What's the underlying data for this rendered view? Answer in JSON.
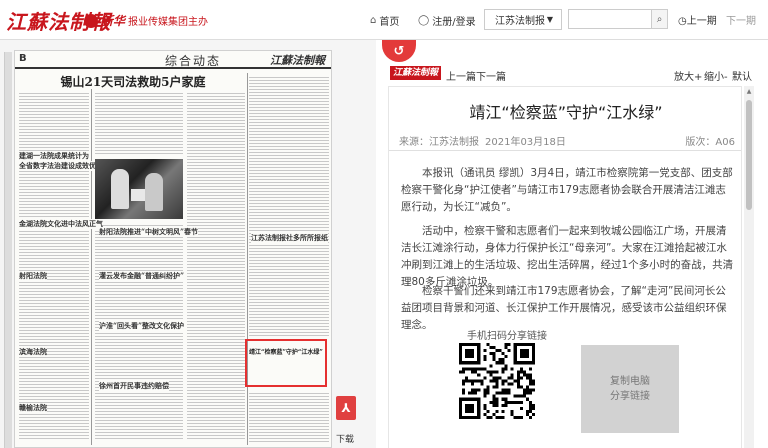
{
  "header": {
    "logo": "江蘇法制報",
    "sponsor_brand": "新华",
    "sponsor_text": "报业传媒集团主办",
    "nav_home": "首页",
    "nav_login": "注册/登录",
    "edition_select": "江苏法制报",
    "search_placeholder": "",
    "prev_page": "上一期",
    "next_page": "下一期"
  },
  "newspaper": {
    "page_letter": "B",
    "section": "综合动态",
    "masthead": "江蘇法制報",
    "headline": "锡山21天司法救助5户家庭",
    "subheads": [
      "建湖一法院成果统计为",
      "全省数字法治建设成效优良",
      "金湖法院文化进中法风正气",
      "射阳法院",
      "滨海法院",
      "赣榆法院",
      "射阳法院推进“中树文明风”春节",
      "灌云发布金融“普通纠纷护”",
      "沪淮“回头看”整改文化保护",
      "徐州首开民事违约赔偿",
      "江苏法制报社多所所报纸"
    ],
    "highlight_text": "靖江“检察蓝”守护“江水绿”",
    "download_label": "下载"
  },
  "article": {
    "logo": "江蘇法制報",
    "prev": "上一篇",
    "next": "下一篇",
    "zoom_in": "放大+",
    "zoom_out": "缩小-",
    "zoom_default": "默认",
    "title": "靖江“检察蓝”守护“江水绿”",
    "source": "来源：江苏法制报",
    "date": "2021年03月18日",
    "edition": "版次：A06",
    "paragraphs": [
      "本报讯（通讯员 缪凯）3月4日，靖江市检察院第一党支部、团支部检察干警化身“护江使者”与靖江市179志愿者协会联合开展清洁江滩志愿行动，为长江“减负”。",
      "活动中，检察干警和志愿者们一起来到牧城公园临江广场，开展清洁长江滩涂行动，身体力行保护长江“母亲河”。大家在江滩拾起被江水冲刷到江滩上的生活垃圾、挖出生活碎屑，经过1个多小时的奋战，共清理80多斤滩涂垃圾。",
      "检察干警们还来到靖江市179志愿者协会，了解“走河”民间河长公益团项目背景和河道、长江保护工作开展情况，感受该市公益组织环保理念。"
    ],
    "qr_label": "手机扫码分享链接",
    "copy_line1": "复制电脑",
    "copy_line2": "分享链接"
  },
  "colors": {
    "brand_red": "#c8161d",
    "highlight_red": "#e53030"
  }
}
